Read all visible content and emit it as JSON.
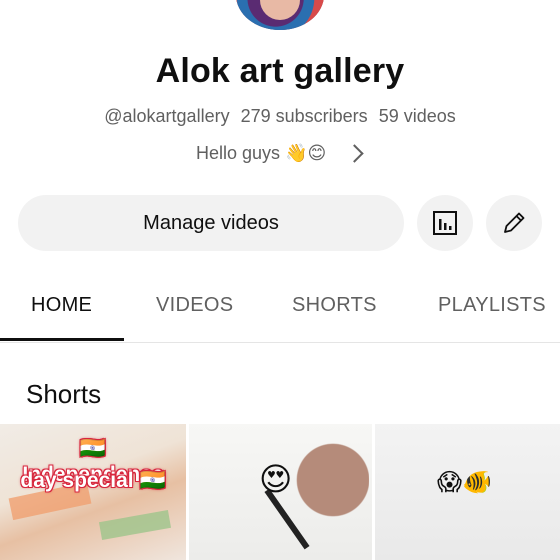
{
  "channel": {
    "name": "Alok art gallery",
    "handle": "@alokartgallery",
    "subscribers": "279 subscribers",
    "videos": "59 videos",
    "description": "Hello guys 👋😊"
  },
  "actions": {
    "manage_label": "Manage videos"
  },
  "tabs": [
    {
      "label": "HOME",
      "active": true
    },
    {
      "label": "VIDEOS",
      "active": false
    },
    {
      "label": "SHORTS",
      "active": false
    },
    {
      "label": "PLAYLISTS",
      "active": false
    }
  ],
  "shorts": {
    "heading": "Shorts",
    "items": [
      {
        "line1": "🇮🇳 Independence",
        "line2": "day special 🇮🇳"
      },
      {
        "emoji": "😍"
      },
      {
        "emoji": "😱🐠"
      }
    ]
  },
  "icons": {
    "analytics": "analytics-icon",
    "edit": "pencil-icon",
    "chevron": "chevron-right-icon"
  }
}
